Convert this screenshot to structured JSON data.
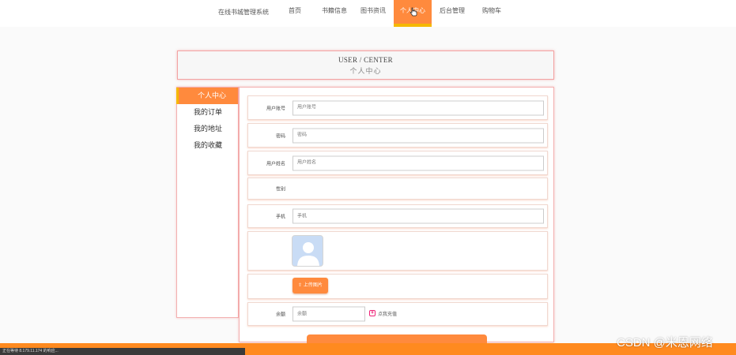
{
  "nav": {
    "brand": "在线书城管理系统",
    "items": [
      {
        "label": "首页",
        "active": false
      },
      {
        "label": "书籍信息",
        "active": false
      },
      {
        "label": "图书资讯",
        "active": false
      },
      {
        "label": "个人中心",
        "active": true
      },
      {
        "label": "后台管理",
        "active": false
      },
      {
        "label": "购物车",
        "active": false
      }
    ]
  },
  "header": {
    "title_en": "USER / CENTER",
    "title_cn": "个人中心"
  },
  "sidebar": {
    "items": [
      {
        "label": "个人中心",
        "active": true
      },
      {
        "label": "我的订单",
        "active": false
      },
      {
        "label": "我的地址",
        "active": false
      },
      {
        "label": "我的收藏",
        "active": false
      }
    ]
  },
  "form": {
    "account": {
      "label": "用户账号",
      "placeholder": "用户账号"
    },
    "password": {
      "label": "密码",
      "placeholder": "密码"
    },
    "name": {
      "label": "用户姓名",
      "placeholder": "用户姓名"
    },
    "gender": {
      "label": "性别"
    },
    "phone": {
      "label": "手机",
      "placeholder": "手机"
    },
    "upload_label": "上传图片",
    "balance": {
      "label": "余额",
      "placeholder": "余额"
    },
    "recharge_label": "点我充值"
  },
  "status_bar": "正在等待 8.179.11.174 的响应...",
  "watermark": "CSDN @米恩网络",
  "colors": {
    "accent": "#ff8a3d",
    "accent_border": "#f5b800",
    "panel_border": "#f3b0b0"
  }
}
